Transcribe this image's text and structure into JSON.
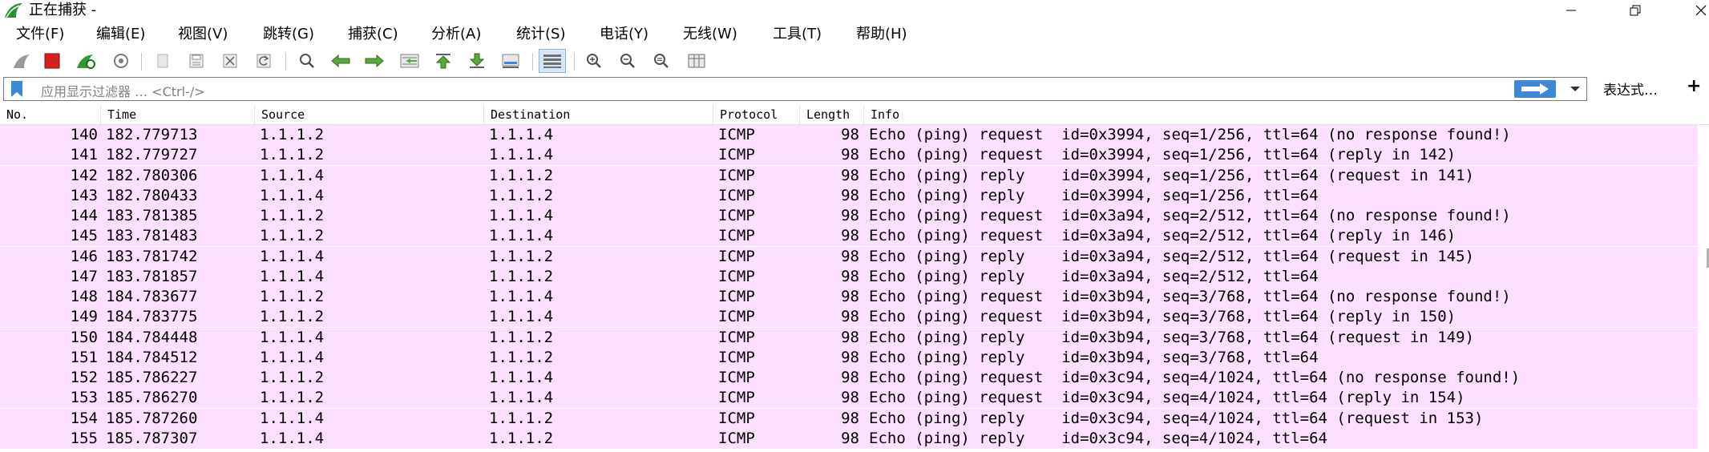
{
  "window": {
    "title": "正在捕获 -"
  },
  "menu": {
    "items": [
      {
        "id": "file",
        "label": "文件(F)"
      },
      {
        "id": "edit",
        "label": "编辑(E)"
      },
      {
        "id": "view",
        "label": "视图(V)"
      },
      {
        "id": "go",
        "label": "跳转(G)"
      },
      {
        "id": "capture",
        "label": "捕获(C)"
      },
      {
        "id": "analyze",
        "label": "分析(A)"
      },
      {
        "id": "statistics",
        "label": "统计(S)"
      },
      {
        "id": "telephony",
        "label": "电话(Y)"
      },
      {
        "id": "wireless",
        "label": "无线(W)"
      },
      {
        "id": "tools",
        "label": "工具(T)"
      },
      {
        "id": "help",
        "label": "帮助(H)"
      }
    ]
  },
  "toolbar": {
    "icons": [
      "shark-fin-start-icon",
      "stop-capture-icon",
      "restart-capture-icon",
      "capture-options-icon",
      "open-file-icon",
      "save-file-icon",
      "close-file-icon",
      "reload-file-icon",
      "find-packet-icon",
      "go-back-icon",
      "go-forward-icon",
      "go-to-packet-icon",
      "go-first-icon",
      "go-last-icon",
      "auto-scroll-icon",
      "colorize-icon",
      "zoom-in-icon",
      "zoom-out-icon",
      "zoom-normal-icon",
      "resize-columns-icon"
    ]
  },
  "filter": {
    "placeholder": "应用显示过滤器 … <Ctrl-/>",
    "expression_label": "表达式…",
    "plus_label": "+"
  },
  "columns": {
    "no": "No.",
    "time": "Time",
    "source": "Source",
    "destination": "Destination",
    "protocol": "Protocol",
    "length": "Length",
    "info": "Info"
  },
  "colors": {
    "row_background": "#fce0ff",
    "accent": "#3f88d6"
  },
  "packets": [
    {
      "no": "140",
      "time": "182.779713",
      "source": "1.1.1.2",
      "destination": "1.1.1.4",
      "protocol": "ICMP",
      "length": "98",
      "info": "Echo (ping) request  id=0x3994, seq=1/256, ttl=64 (no response found!)"
    },
    {
      "no": "141",
      "time": "182.779727",
      "source": "1.1.1.2",
      "destination": "1.1.1.4",
      "protocol": "ICMP",
      "length": "98",
      "info": "Echo (ping) request  id=0x3994, seq=1/256, ttl=64 (reply in 142)"
    },
    {
      "no": "142",
      "time": "182.780306",
      "source": "1.1.1.4",
      "destination": "1.1.1.2",
      "protocol": "ICMP",
      "length": "98",
      "info": "Echo (ping) reply    id=0x3994, seq=1/256, ttl=64 (request in 141)"
    },
    {
      "no": "143",
      "time": "182.780433",
      "source": "1.1.1.4",
      "destination": "1.1.1.2",
      "protocol": "ICMP",
      "length": "98",
      "info": "Echo (ping) reply    id=0x3994, seq=1/256, ttl=64"
    },
    {
      "no": "144",
      "time": "183.781385",
      "source": "1.1.1.2",
      "destination": "1.1.1.4",
      "protocol": "ICMP",
      "length": "98",
      "info": "Echo (ping) request  id=0x3a94, seq=2/512, ttl=64 (no response found!)"
    },
    {
      "no": "145",
      "time": "183.781483",
      "source": "1.1.1.2",
      "destination": "1.1.1.4",
      "protocol": "ICMP",
      "length": "98",
      "info": "Echo (ping) request  id=0x3a94, seq=2/512, ttl=64 (reply in 146)"
    },
    {
      "no": "146",
      "time": "183.781742",
      "source": "1.1.1.4",
      "destination": "1.1.1.2",
      "protocol": "ICMP",
      "length": "98",
      "info": "Echo (ping) reply    id=0x3a94, seq=2/512, ttl=64 (request in 145)"
    },
    {
      "no": "147",
      "time": "183.781857",
      "source": "1.1.1.4",
      "destination": "1.1.1.2",
      "protocol": "ICMP",
      "length": "98",
      "info": "Echo (ping) reply    id=0x3a94, seq=2/512, ttl=64"
    },
    {
      "no": "148",
      "time": "184.783677",
      "source": "1.1.1.2",
      "destination": "1.1.1.4",
      "protocol": "ICMP",
      "length": "98",
      "info": "Echo (ping) request  id=0x3b94, seq=3/768, ttl=64 (no response found!)"
    },
    {
      "no": "149",
      "time": "184.783775",
      "source": "1.1.1.2",
      "destination": "1.1.1.4",
      "protocol": "ICMP",
      "length": "98",
      "info": "Echo (ping) request  id=0x3b94, seq=3/768, ttl=64 (reply in 150)"
    },
    {
      "no": "150",
      "time": "184.784448",
      "source": "1.1.1.4",
      "destination": "1.1.1.2",
      "protocol": "ICMP",
      "length": "98",
      "info": "Echo (ping) reply    id=0x3b94, seq=3/768, ttl=64 (request in 149)"
    },
    {
      "no": "151",
      "time": "184.784512",
      "source": "1.1.1.4",
      "destination": "1.1.1.2",
      "protocol": "ICMP",
      "length": "98",
      "info": "Echo (ping) reply    id=0x3b94, seq=3/768, ttl=64"
    },
    {
      "no": "152",
      "time": "185.786227",
      "source": "1.1.1.2",
      "destination": "1.1.1.4",
      "protocol": "ICMP",
      "length": "98",
      "info": "Echo (ping) request  id=0x3c94, seq=4/1024, ttl=64 (no response found!)"
    },
    {
      "no": "153",
      "time": "185.786270",
      "source": "1.1.1.2",
      "destination": "1.1.1.4",
      "protocol": "ICMP",
      "length": "98",
      "info": "Echo (ping) request  id=0x3c94, seq=4/1024, ttl=64 (reply in 154)"
    },
    {
      "no": "154",
      "time": "185.787260",
      "source": "1.1.1.4",
      "destination": "1.1.1.2",
      "protocol": "ICMP",
      "length": "98",
      "info": "Echo (ping) reply    id=0x3c94, seq=4/1024, ttl=64 (request in 153)"
    },
    {
      "no": "155",
      "time": "185.787307",
      "source": "1.1.1.4",
      "destination": "1.1.1.2",
      "protocol": "ICMP",
      "length": "98",
      "info": "Echo (ping) reply    id=0x3c94, seq=4/1024, ttl=64"
    }
  ]
}
